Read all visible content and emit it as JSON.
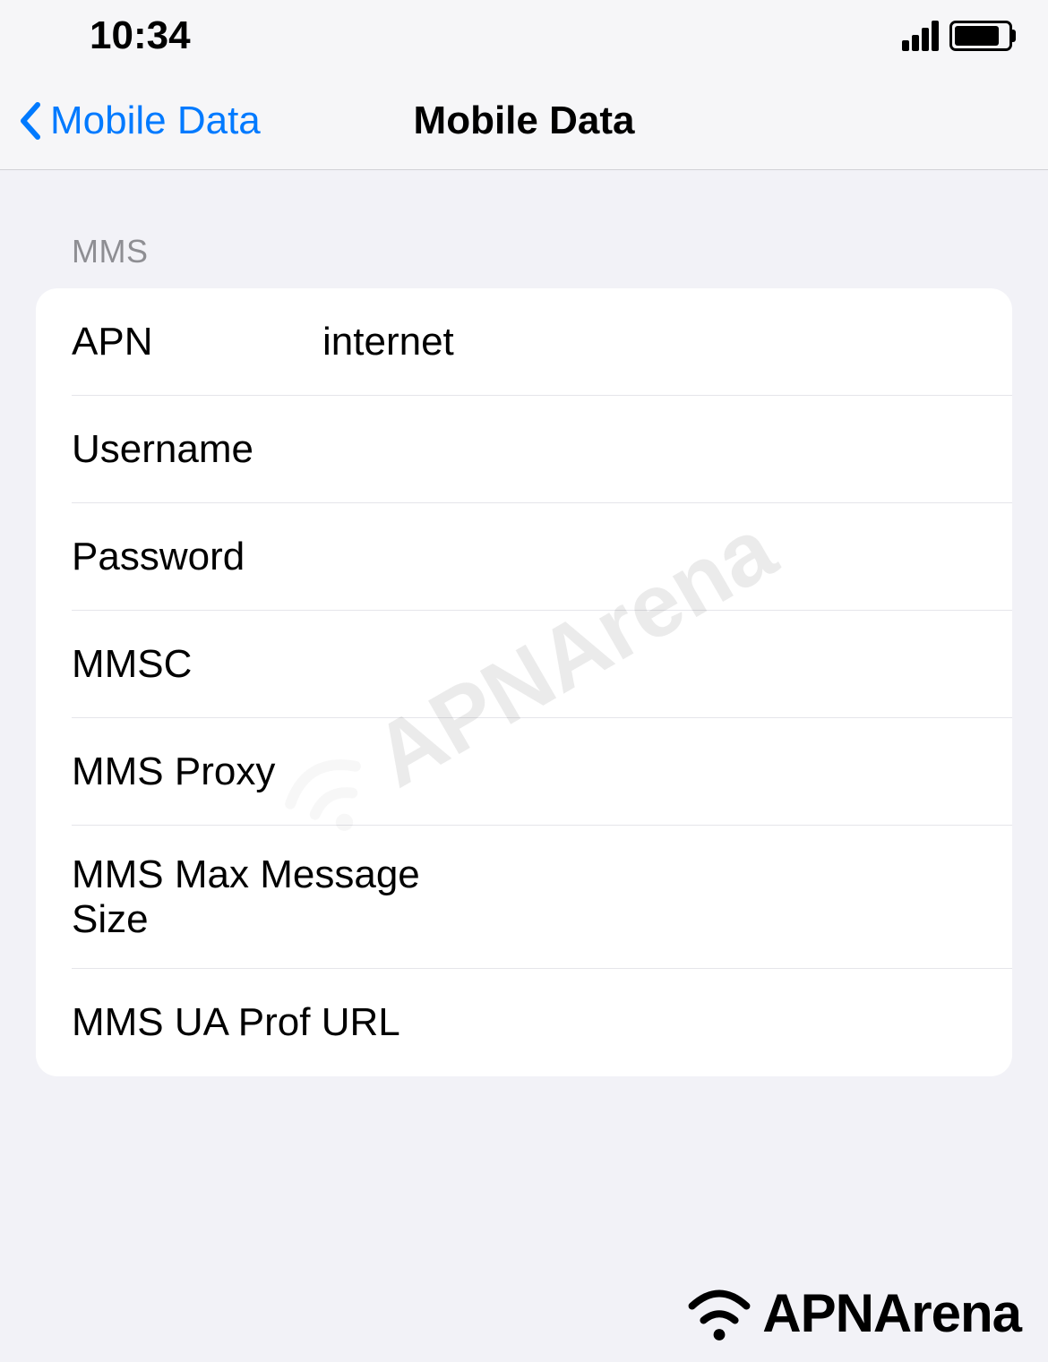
{
  "statusBar": {
    "time": "10:34"
  },
  "navBar": {
    "backLabel": "Mobile Data",
    "title": "Mobile Data"
  },
  "section": {
    "header": "MMS",
    "rows": [
      {
        "label": "APN",
        "value": "internet"
      },
      {
        "label": "Username",
        "value": ""
      },
      {
        "label": "Password",
        "value": ""
      },
      {
        "label": "MMSC",
        "value": ""
      },
      {
        "label": "MMS Proxy",
        "value": ""
      },
      {
        "label": "MMS Max Message Size",
        "value": ""
      },
      {
        "label": "MMS UA Prof URL",
        "value": ""
      }
    ]
  },
  "watermark": "APNArena",
  "logo": "APNArena"
}
